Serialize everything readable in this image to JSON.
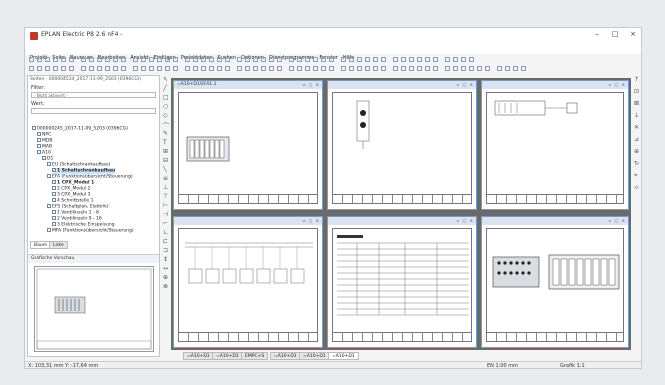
{
  "window": {
    "title": "EPLAN Electric P8 2.6 nF4 -",
    "controls": [
      "–",
      "□",
      "×"
    ]
  },
  "menu": [
    "Projekt",
    "Seite",
    "Bauraum",
    "Bearbeiten",
    "Ansicht",
    "Einfügen",
    "Projektdaten",
    "Suchen",
    "Optionen",
    "Dienstprogramme",
    "Fenster",
    "Hilfe"
  ],
  "page_nav": {
    "header": "Seiten - 000004534_2017-11-09_2S03 (0396CGl)",
    "filter_label": "Filter:",
    "filter_value": "- Nicht aktiviert -",
    "value_label": "Wert:",
    "tree": [
      {
        "label": "000000245_2017-11-09_5203 (0396CG)",
        "indent": 0,
        "selected": false
      },
      {
        "label": "NPC",
        "indent": 1,
        "selected": false
      },
      {
        "label": "MDB",
        "indent": 1,
        "selected": false
      },
      {
        "label": "MAB",
        "indent": 1,
        "selected": false
      },
      {
        "label": "A10",
        "indent": 1,
        "selected": false
      },
      {
        "label": "D1",
        "indent": 2,
        "selected": false
      },
      {
        "label": "EU (Schaltschrankaufbau)",
        "indent": 3,
        "selected": false
      },
      {
        "label": "1 Schaltschrankaufbau",
        "indent": 4,
        "selected": true
      },
      {
        "label": "EFA (Funktionsübersicht/Steuerung)",
        "indent": 3,
        "selected": false
      },
      {
        "label": "1 CPX_Modul 1",
        "indent": 4,
        "selected": false
      },
      {
        "label": "2 CPX_Modul 2",
        "indent": 4,
        "selected": false
      },
      {
        "label": "3 CPX_Modul 3",
        "indent": 4,
        "selected": false
      },
      {
        "label": "4 Schnittstelle 1",
        "indent": 4,
        "selected": false
      },
      {
        "label": "EFS (Schaltplan, Elektrik)",
        "indent": 3,
        "selected": false
      },
      {
        "label": "1 Ventilinseln 1 - 8",
        "indent": 4,
        "selected": false
      },
      {
        "label": "2 Ventilinseln 9 - 16",
        "indent": 4,
        "selected": false
      },
      {
        "label": "3 Elektrische Einspeisung",
        "indent": 4,
        "selected": false
      },
      {
        "label": "MFA (Funktionsübersicht/Steuerung)",
        "indent": 3,
        "selected": false
      }
    ],
    "tabs": [
      "Baum",
      "Liste"
    ],
    "active_tab": "Baum",
    "preview_label": "Grafische Vorschau"
  },
  "pages": [
    {
      "title": "=A10+D1/EFA1.1"
    },
    {
      "title": ""
    },
    {
      "title": ""
    },
    {
      "title": ""
    },
    {
      "title": ""
    },
    {
      "title": ""
    }
  ],
  "doc_tabs": [
    "=A10+D1",
    "=A10+D1",
    "EMPC+S",
    "=A10+D1",
    "=A10+D1",
    "=A10+D1"
  ],
  "active_doc_tab": 5,
  "status": {
    "coords": "X: 103,31 mm  Y: -17,64 mm",
    "grid": "EN 1:00 mm",
    "view": "Grafik 1:1"
  }
}
